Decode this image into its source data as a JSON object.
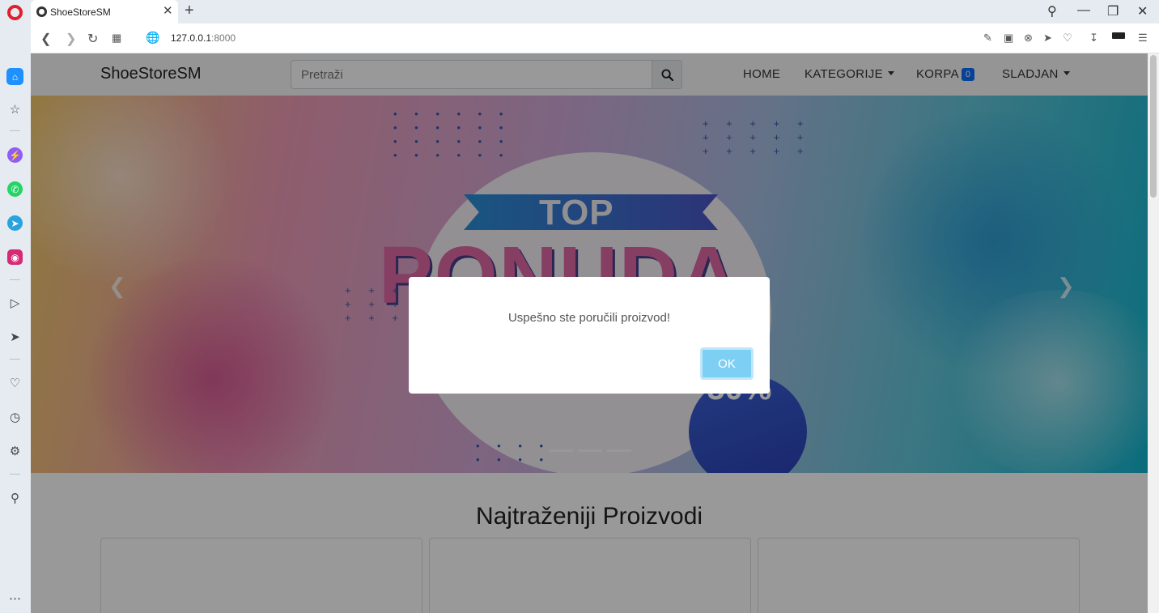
{
  "browser": {
    "tab_title": "ShoeStoreSM",
    "url_host": "127.0.0.1",
    "url_port": ":8000"
  },
  "sidebar": {
    "icons": [
      "home-icon",
      "star-icon",
      "messenger-icon",
      "whatsapp-icon",
      "telegram-icon",
      "instagram-icon",
      "player-icon",
      "send-icon",
      "heart-icon",
      "history-icon",
      "settings-icon",
      "lightbulb-icon",
      "more-icon"
    ]
  },
  "navbar": {
    "brand": "ShoeStoreSM",
    "search_placeholder": "Pretraži",
    "home": "HOME",
    "categories": "KATEGORIJE",
    "cart": "KORPA",
    "cart_count": "0",
    "user": "SLADJAN"
  },
  "hero": {
    "banner_top": "TOP",
    "banner_main": "PONUDA",
    "discount": "-50%"
  },
  "section": {
    "title": "Najtraženiji Proizvodi"
  },
  "modal": {
    "message": "Uspešno ste poručili proizvod!",
    "ok_label": "OK"
  },
  "colors": {
    "badge": "#0d6efd",
    "ok_button": "#7ecff4"
  }
}
